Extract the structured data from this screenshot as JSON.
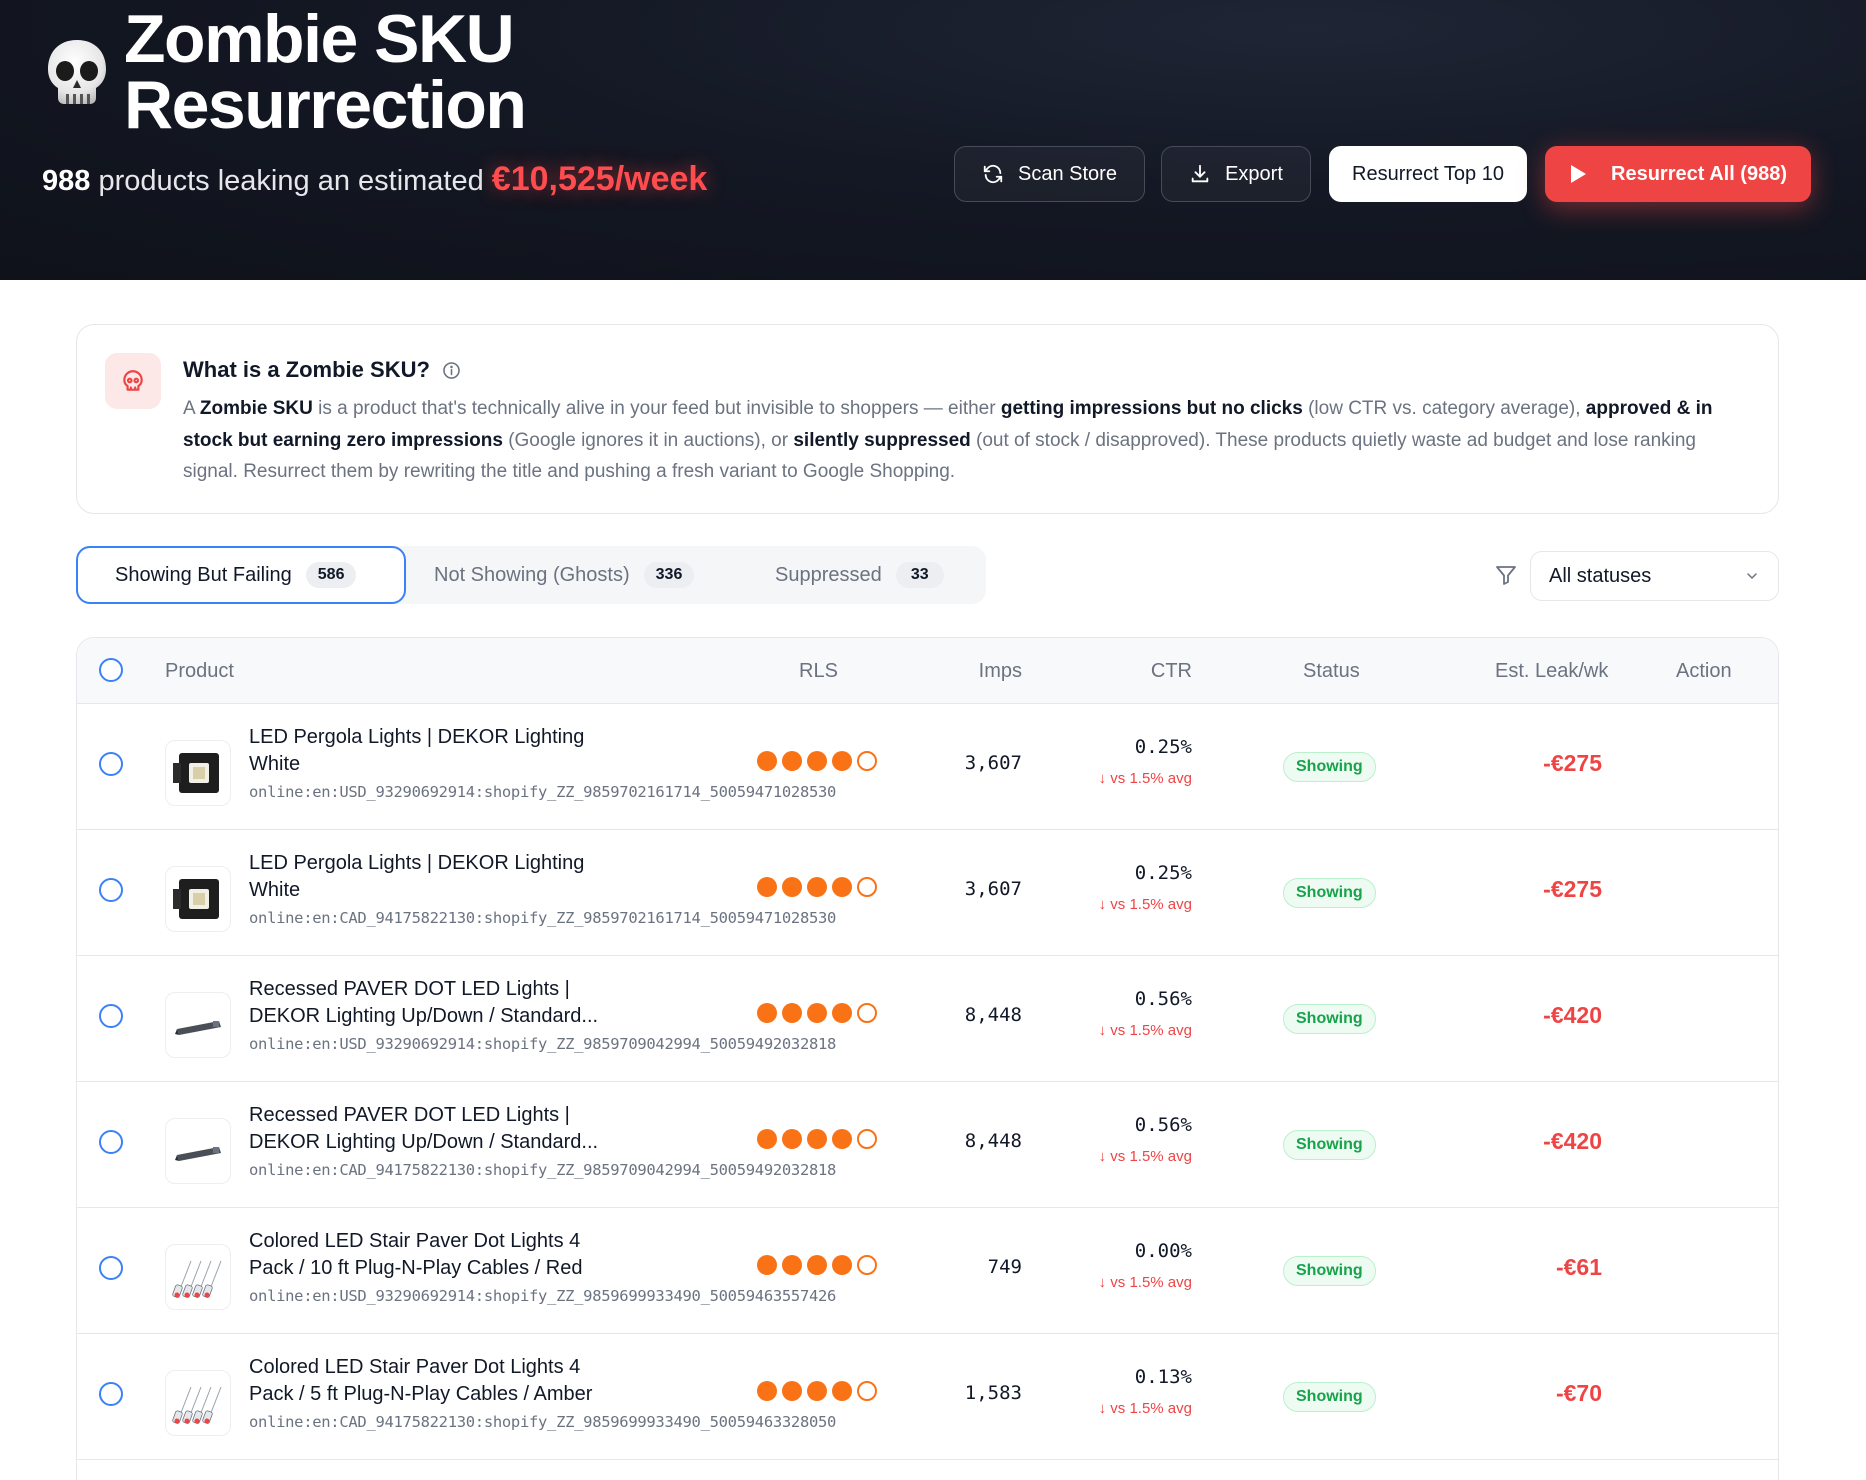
{
  "header": {
    "title_line1": "Zombie SKU",
    "title_line2": "Resurrection",
    "count": "988",
    "subtitle_mid": " products leaking an estimated ",
    "leak_amount": "€10,525/week",
    "buttons": {
      "scan": "Scan Store",
      "export": "Export",
      "top10": "Resurrect Top 10",
      "all": "Resurrect All (988)"
    },
    "colors": {
      "accent": "#ef4444",
      "background": "#141824"
    }
  },
  "info": {
    "title": "What is a Zombie SKU?",
    "p1": "A ",
    "b1": "Zombie SKU",
    "p2": " is a product that's technically alive in your feed but invisible to shoppers — either ",
    "b2": "getting impressions but no clicks",
    "p3": " (low CTR vs. category average), ",
    "b3": "approved & in stock but earning zero impressions",
    "p4": " (Google ignores it in auctions), or ",
    "b4": "silently suppressed",
    "p5": " (out of stock / disapproved). These products quietly waste ad budget and lose ranking signal. Resurrect them by rewriting the title and pushing a fresh variant to Google Shopping."
  },
  "tabs": [
    {
      "label": "Showing But Failing",
      "count": "586"
    },
    {
      "label": "Not Showing (Ghosts)",
      "count": "336"
    },
    {
      "label": "Suppressed",
      "count": "33"
    }
  ],
  "filter": {
    "selected": "All statuses"
  },
  "table": {
    "headers": {
      "product": "Product",
      "rls": "RLS",
      "imps": "Imps",
      "ctr": "CTR",
      "status": "Status",
      "leak": "Est. Leak/wk",
      "action": "Action"
    },
    "rows": [
      {
        "name": "LED Pergola Lights | DEKOR Lighting White",
        "id": "online:en:USD_93290692914:shopify_ZZ_9859702161714_50059471028530",
        "rls": 4,
        "rls_max": 5,
        "imps": "3,607",
        "ctr": "0.25%",
        "ctr_note": "vs 1.5% avg",
        "status": "Showing",
        "leak": "-€275",
        "thumb": "pergola-light"
      },
      {
        "name": "LED Pergola Lights | DEKOR Lighting White",
        "id": "online:en:CAD_94175822130:shopify_ZZ_9859702161714_50059471028530",
        "rls": 4,
        "rls_max": 5,
        "imps": "3,607",
        "ctr": "0.25%",
        "ctr_note": "vs 1.5% avg",
        "status": "Showing",
        "leak": "-€275",
        "thumb": "pergola-light"
      },
      {
        "name": "Recessed PAVER DOT LED Lights | DEKOR Lighting Up/Down / Standard...",
        "id": "online:en:USD_93290692914:shopify_ZZ_9859709042994_50059492032818",
        "rls": 4,
        "rls_max": 5,
        "imps": "8,448",
        "ctr": "0.56%",
        "ctr_note": "vs 1.5% avg",
        "status": "Showing",
        "leak": "-€420",
        "thumb": "paver-light"
      },
      {
        "name": "Recessed PAVER DOT LED Lights | DEKOR Lighting Up/Down / Standard...",
        "id": "online:en:CAD_94175822130:shopify_ZZ_9859709042994_50059492032818",
        "rls": 4,
        "rls_max": 5,
        "imps": "8,448",
        "ctr": "0.56%",
        "ctr_note": "vs 1.5% avg",
        "status": "Showing",
        "leak": "-€420",
        "thumb": "paver-light"
      },
      {
        "name": "Colored LED Stair Paver Dot Lights 4 Pack / 10 ft Plug-N-Play Cables / Red",
        "id": "online:en:USD_93290692914:shopify_ZZ_9859699933490_50059463557426",
        "rls": 4,
        "rls_max": 5,
        "imps": "749",
        "ctr": "0.00%",
        "ctr_note": "vs 1.5% avg",
        "status": "Showing",
        "leak": "-€61",
        "thumb": "stair-lights"
      },
      {
        "name": "Colored LED Stair Paver Dot Lights 4 Pack / 5 ft Plug-N-Play Cables / Amber",
        "id": "online:en:CAD_94175822130:shopify_ZZ_9859699933490_50059463328050",
        "rls": 4,
        "rls_max": 5,
        "imps": "1,583",
        "ctr": "0.13%",
        "ctr_note": "vs 1.5% avg",
        "status": "Showing",
        "leak": "-€70",
        "thumb": "stair-lights"
      }
    ]
  }
}
